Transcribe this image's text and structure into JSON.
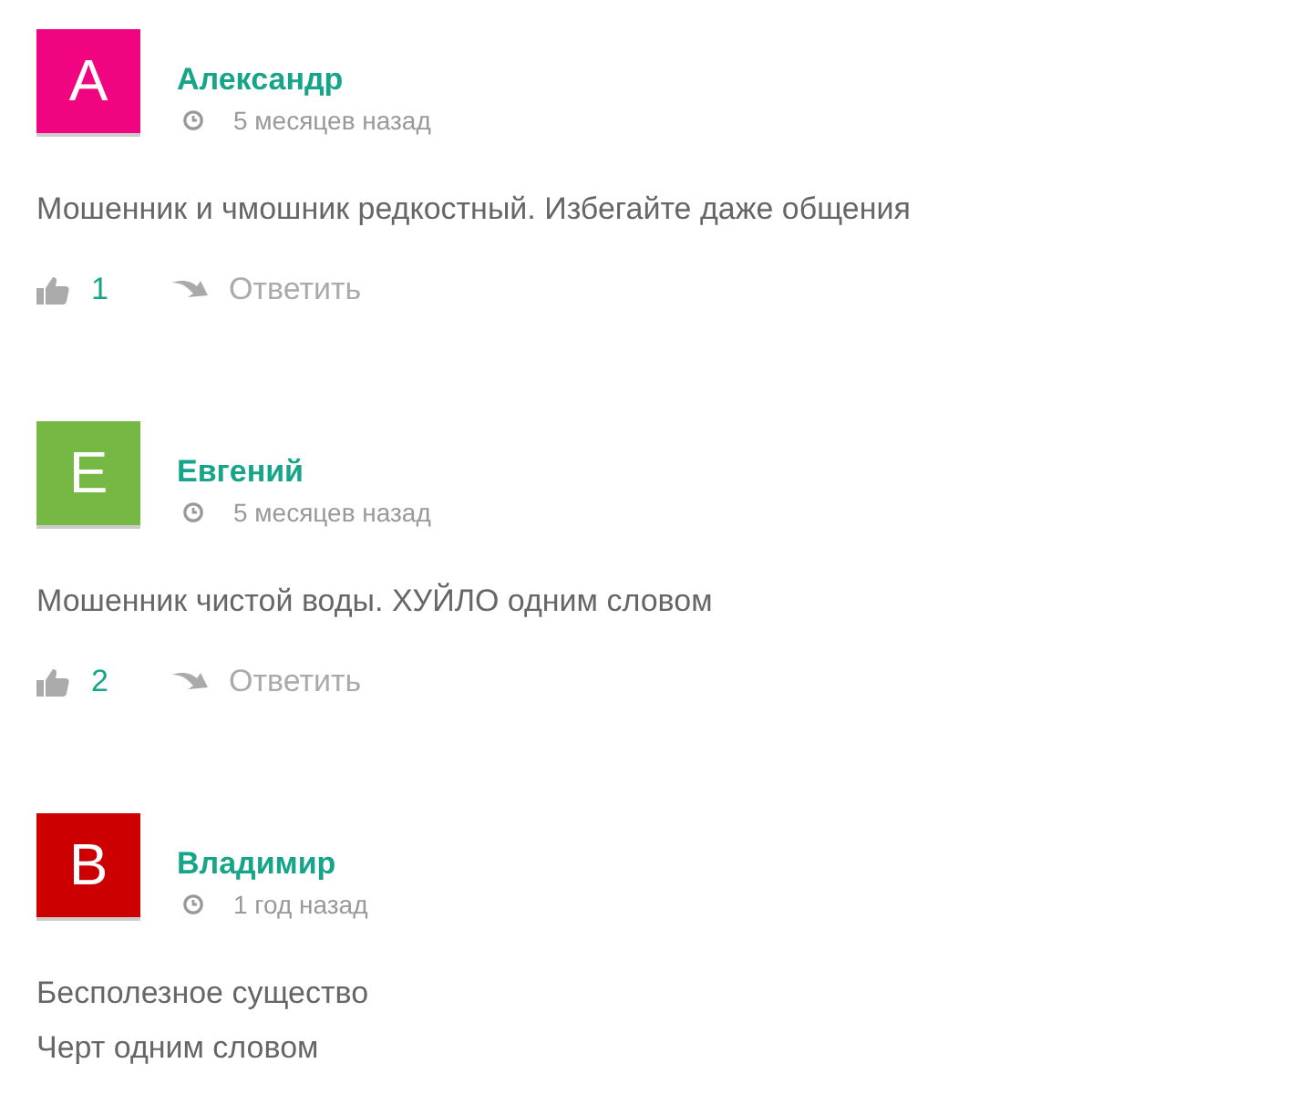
{
  "comments": [
    {
      "avatar": {
        "letter": "А",
        "color": "#f0047f"
      },
      "author": "Александр",
      "time": "5 месяцев назад",
      "lines": [
        "Мошенник и чмошник редкостный. Избегайте даже общения"
      ],
      "actions": {
        "likes": "1",
        "reply": "Ответить"
      }
    },
    {
      "avatar": {
        "letter": "Е",
        "color": "#76b844"
      },
      "author": "Евгений",
      "time": "5 месяцев назад",
      "lines": [
        "Мошенник чистой воды. ХУЙЛО одним словом"
      ],
      "actions": {
        "likes": "2",
        "reply": "Ответить"
      }
    },
    {
      "avatar": {
        "letter": "В",
        "color": "#cc0000"
      },
      "author": "Владимир",
      "time": "1 год назад",
      "lines": [
        "Бесполезное существо",
        "Черт одним словом"
      ]
    }
  ]
}
